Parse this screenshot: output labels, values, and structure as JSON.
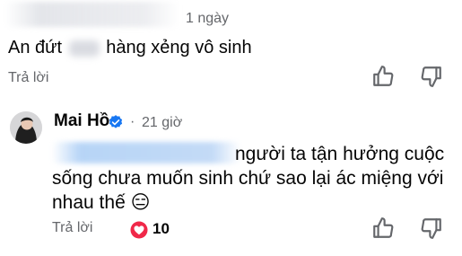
{
  "comment1": {
    "time": "1 ngày",
    "text_before": "An đứt",
    "text_after": "hàng xẻng vô sinh",
    "reply_label": "Trả lời"
  },
  "comment2": {
    "author": "Mai Hồ",
    "separator": "·",
    "time": "21 giờ",
    "text_line1": "người ta tận hưởng cuộc",
    "text_rest": "sống chưa muốn sinh chứ sao lại ác miệng với nhau thế",
    "emoji": "😑",
    "reply_label": "Trả lời",
    "reaction_count": "10"
  },
  "icons": {
    "like": "thumbs-up-icon",
    "dislike": "thumbs-down-icon",
    "verified": "verified-badge-icon",
    "reaction": "heart-reaction-icon"
  },
  "colors": {
    "text": "#050505",
    "secondary": "#65676b",
    "verified": "#1877f2",
    "heart": "#f02849"
  }
}
